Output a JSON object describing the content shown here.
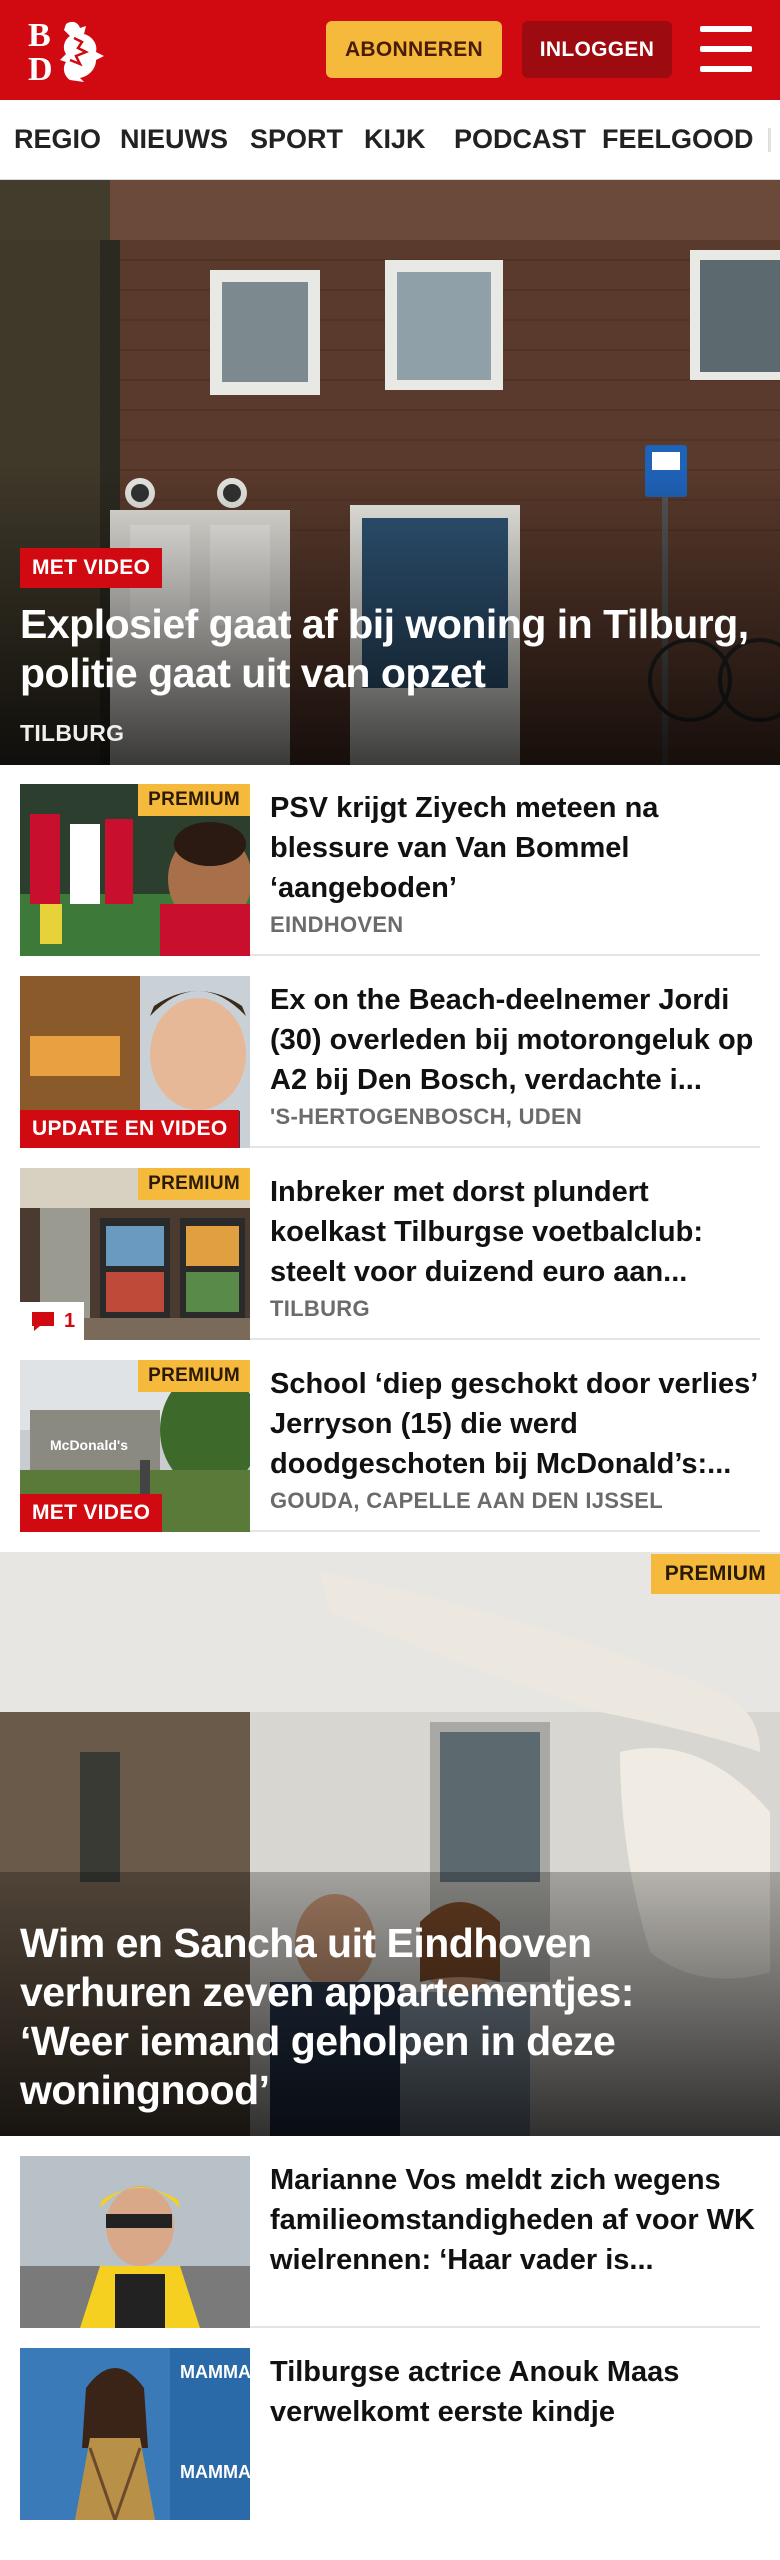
{
  "header": {
    "logo_text": "BD",
    "subscribe_label": "ABONNEREN",
    "login_label": "INLOGGEN",
    "menu_icon": "hamburger-menu-icon"
  },
  "nav": {
    "items": [
      "REGIO",
      "NIEUWS",
      "SPORT",
      "KIJK",
      "PODCAST",
      "FEELGOOD"
    ]
  },
  "hero": {
    "badge": "MET VIDEO",
    "title": "Explosief gaat af bij woning in Tilburg, politie gaat uit van opzet",
    "location": "TILBURG"
  },
  "articles": [
    {
      "title": "PSV krijgt Ziyech meteen na blessure van Van Bommel ‘aangeboden’",
      "location": "EINDHOVEN",
      "premium": "PREMIUM"
    },
    {
      "title": "Ex on the Beach-deelnemer Jordi (30) overleden bij motorongeluk op A2 bij Den Bosch, verdachte i...",
      "location": "'S-HERTOGENBOSCH, UDEN",
      "badge": "UPDATE EN VIDEO"
    },
    {
      "title": "Inbreker met dorst plundert koelkast Tilburgse voetbalclub: steelt voor duizend euro aan...",
      "location": "TILBURG",
      "premium": "PREMIUM",
      "comments": "1"
    },
    {
      "title": "School ‘diep geschokt door verlies’ Jerryson (15) die werd doodgeschoten bij McDonald’s:...",
      "location": "GOUDA, CAPELLE AAN DEN IJSSEL",
      "premium": "PREMIUM",
      "badge": "MET VIDEO"
    }
  ],
  "feature": {
    "premium": "PREMIUM",
    "title": "Wim en Sancha uit Eindhoven verhuren zeven appartementjes: ‘Weer iemand geholpen in deze woningnood’"
  },
  "bottom_articles": [
    {
      "title": "Marianne Vos meldt zich wegens familieomstandigheden af voor WK wielrennen: ‘Haar vader is..."
    },
    {
      "title": "Tilburgse actrice Anouk Maas verwelkomt eerste kindje"
    }
  ],
  "colors": {
    "brand_red": "#d10a11",
    "premium_yellow": "#f5b93b",
    "login_dark_red": "#9d0b10"
  }
}
